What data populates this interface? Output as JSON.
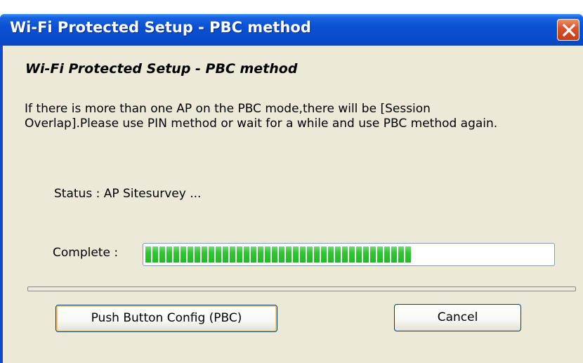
{
  "window": {
    "title": "Wi-Fi Protected Setup - PBC method",
    "close_icon": "close-icon",
    "accent_color": "#0a4ccd",
    "close_color": "#d9542c"
  },
  "content": {
    "heading": "Wi-Fi Protected Setup - PBC method",
    "message_lines": [
      "If there is more than one AP on the PBC mode,there will be [Session",
      "Overlap].Please use PIN method or wait for a while and use PBC method again."
    ],
    "status": "Status : AP Sitesurvey ...",
    "complete_label": "Complete :",
    "progress_fraction": 0.67,
    "progress_color": "#2fc432"
  },
  "buttons": {
    "pbc_label": "Push Button Config (PBC)",
    "cancel_label": "Cancel"
  }
}
